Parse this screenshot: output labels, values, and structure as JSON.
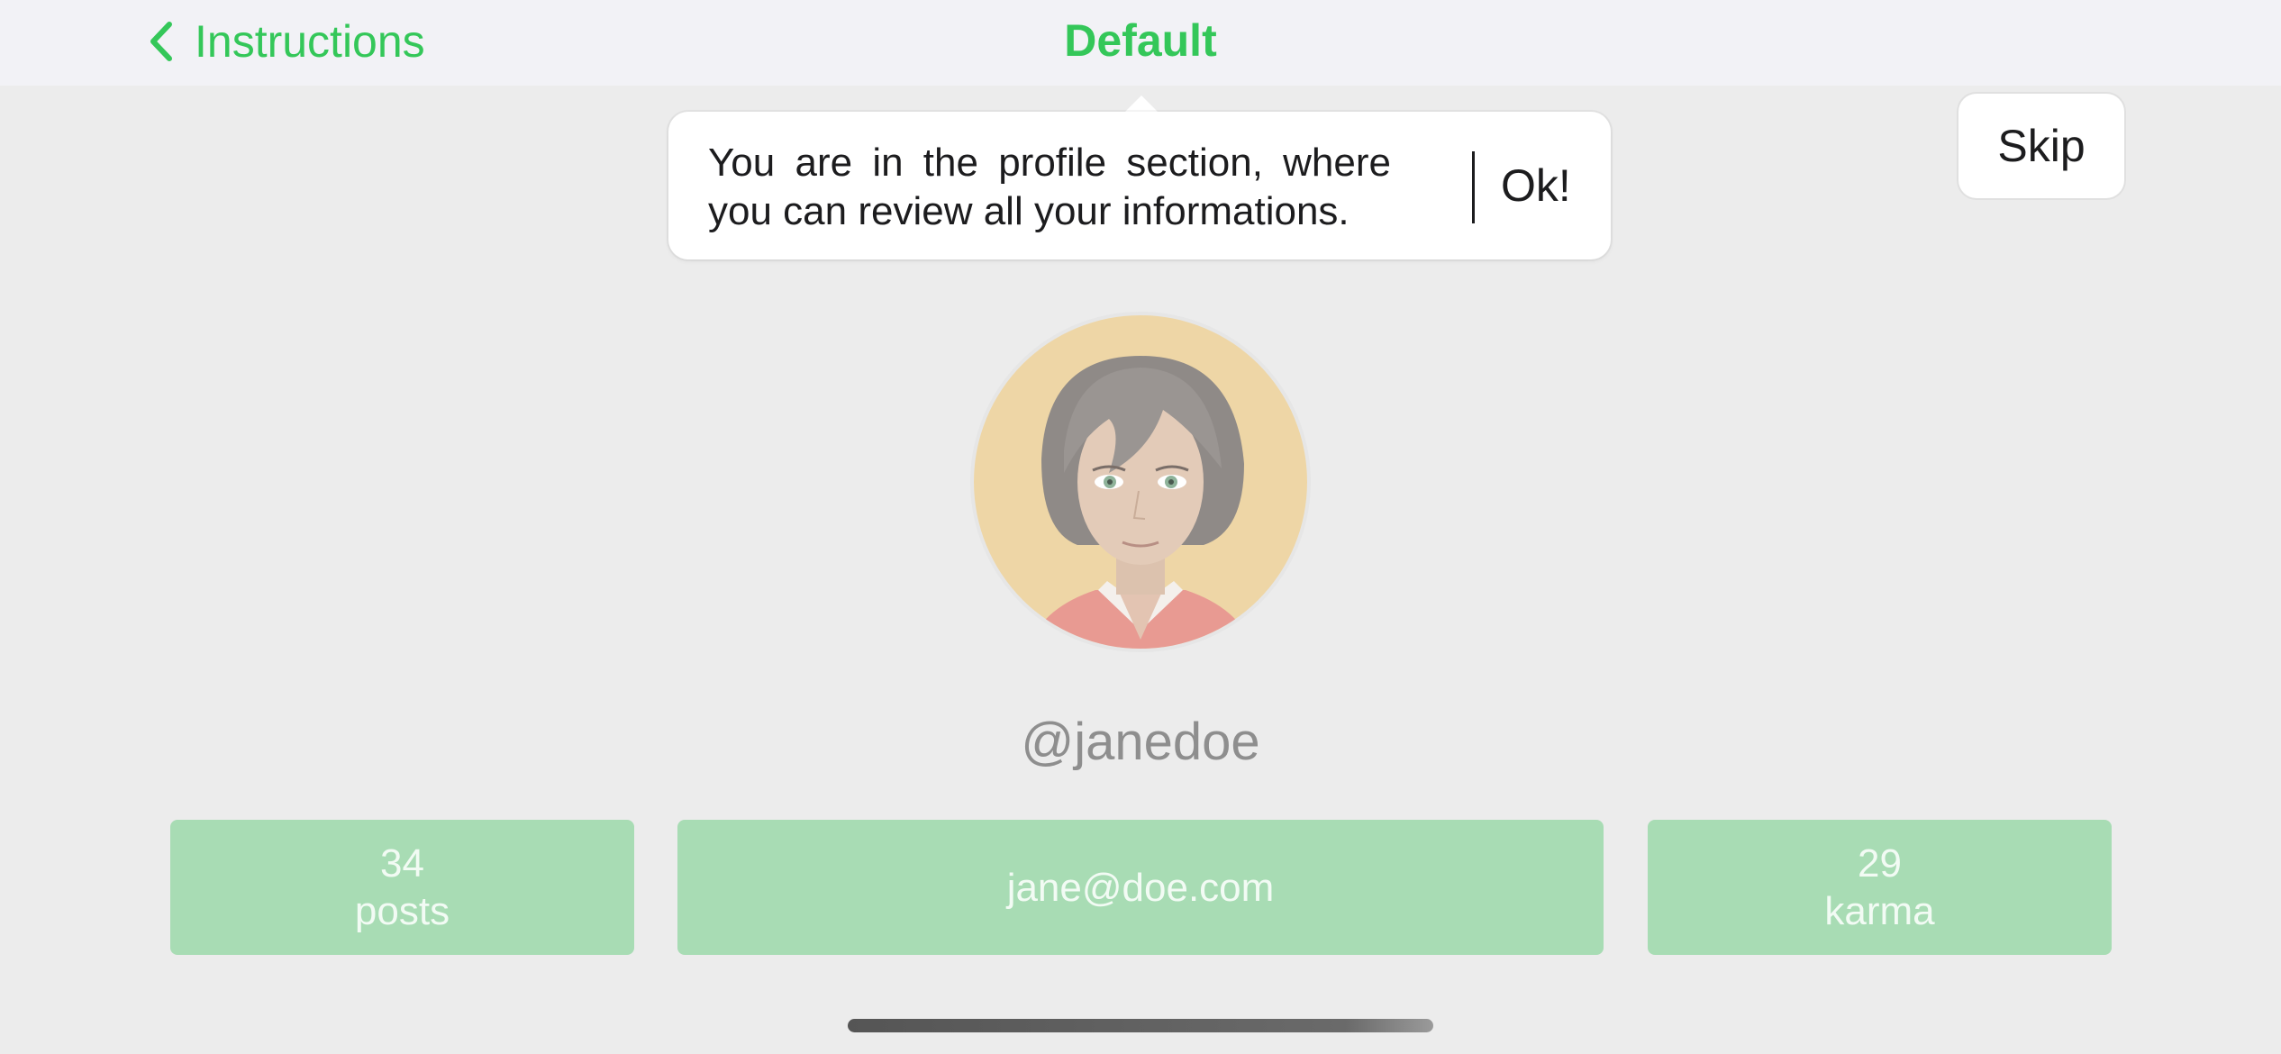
{
  "navbar": {
    "back_label": "Instructions",
    "title": "Default"
  },
  "tooltip": {
    "message": "You are in the profile section, where you can review all your informations.",
    "ok_label": "Ok!"
  },
  "skip_label": "Skip",
  "profile": {
    "avatar_icon": "avatar-illustration",
    "username": "@janedoe",
    "stats": {
      "posts": {
        "value": "34",
        "label": "posts"
      },
      "email": "jane@doe.com",
      "karma": {
        "value": "29",
        "label": "karma"
      }
    }
  },
  "colors": {
    "accent": "#34c759",
    "stat_background": "#a8dcb4",
    "overlay_background": "#ececec"
  }
}
